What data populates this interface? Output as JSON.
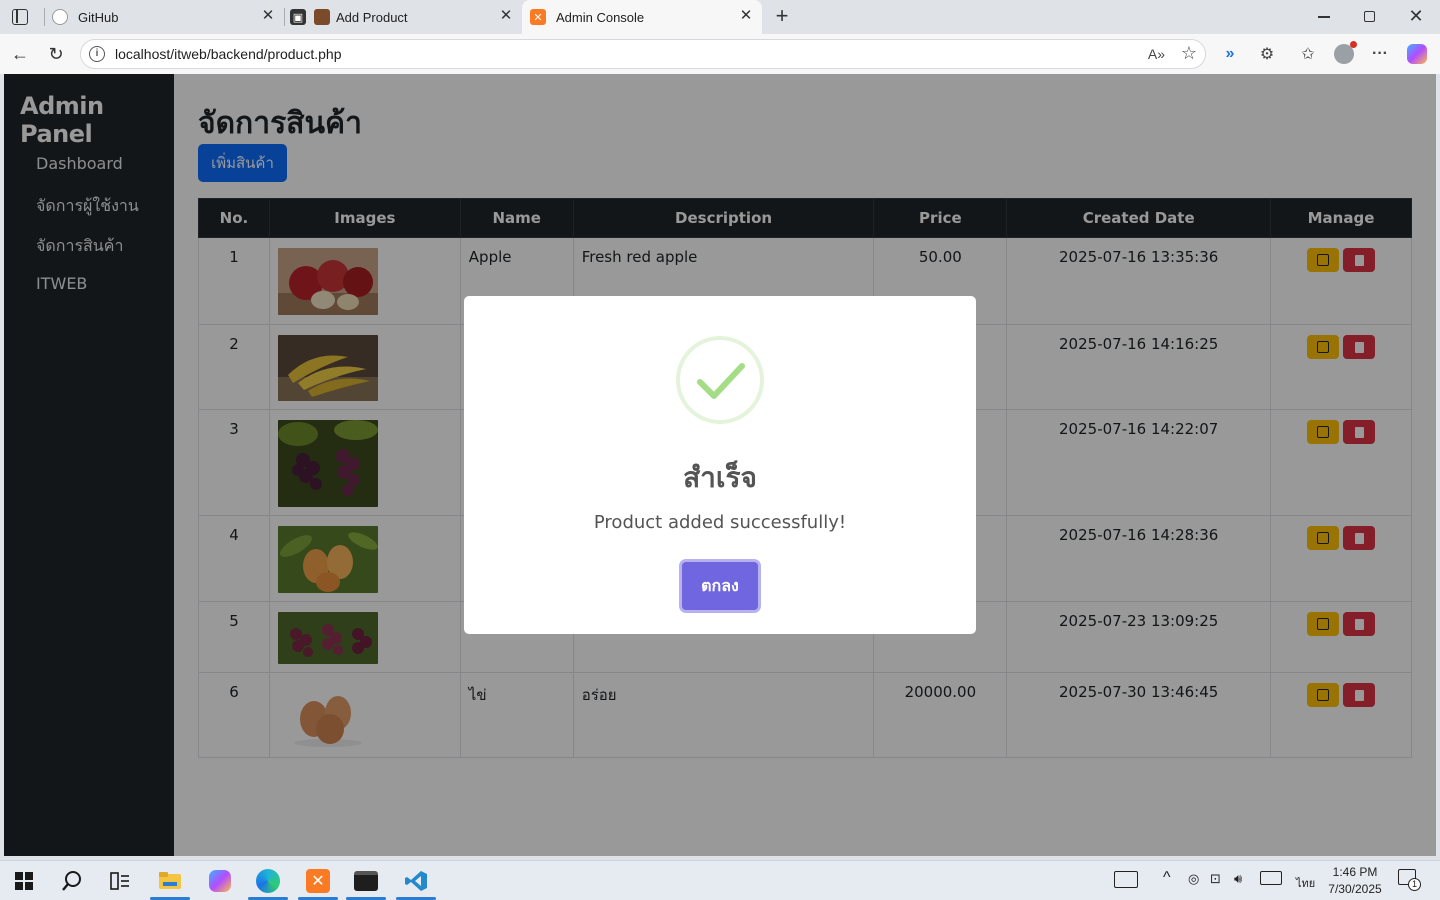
{
  "browser": {
    "tabs": [
      {
        "label": "GitHub",
        "icon": "github-icon"
      },
      {
        "label": "Add Product",
        "icon": "box-icon"
      },
      {
        "label": "Admin Console",
        "icon": "xampp-icon"
      }
    ],
    "url": "localhost/itweb/backend/product.php",
    "read_aloud": "A»"
  },
  "sidebar": {
    "brand": "Admin Panel",
    "items": [
      {
        "label": "Dashboard"
      },
      {
        "label": "จัดการผู้ใช้งาน"
      },
      {
        "label": "จัดการสินค้า"
      },
      {
        "label": "ITWEB"
      }
    ]
  },
  "main": {
    "title": "จัดการสินค้า",
    "add_button": "เพิ่มสินค้า",
    "table": {
      "headers": [
        "No.",
        "Images",
        "Name",
        "Description",
        "Price",
        "Created Date",
        "Manage"
      ],
      "rows": [
        {
          "no": "1",
          "name": "Apple",
          "description": "Fresh red apple",
          "price": "50.00",
          "created": "2025-07-16 13:35:36",
          "image": "apples"
        },
        {
          "no": "2",
          "name": "",
          "description": "",
          "price": "",
          "created": "2025-07-16 14:16:25",
          "image": "bananas"
        },
        {
          "no": "3",
          "name": "",
          "description": "",
          "price": "",
          "created": "2025-07-16 14:22:07",
          "image": "grapes"
        },
        {
          "no": "4",
          "name": "",
          "description": "",
          "price": "",
          "created": "2025-07-16 14:28:36",
          "image": "mangoes"
        },
        {
          "no": "5",
          "name": "",
          "description": "",
          "price": "",
          "created": "2025-07-23 13:09:25",
          "image": "red-grapes"
        },
        {
          "no": "6",
          "name": "ไข่",
          "description": "อร่อย",
          "price": "20000.00",
          "created": "2025-07-30 13:46:45",
          "image": "eggs"
        }
      ]
    }
  },
  "modal": {
    "title": "สำเร็จ",
    "text": "Product added successfully!",
    "confirm": "ตกลง",
    "icon": "success-check-icon"
  },
  "taskbar": {
    "apps": [
      "windows-start",
      "search",
      "task-view",
      "file-explorer",
      "copilot",
      "edge",
      "xampp",
      "terminal",
      "vscode"
    ],
    "lang": "ไทย",
    "time": "1:46 PM",
    "date": "7/30/2025",
    "notifications": "1"
  },
  "colors": {
    "sidebar_bg": "#212529",
    "primary": "#0d6efd",
    "warning": "#ffc107",
    "danger": "#dc3545",
    "swal_confirm": "#7066e0",
    "swal_success": "#a5dc86"
  }
}
